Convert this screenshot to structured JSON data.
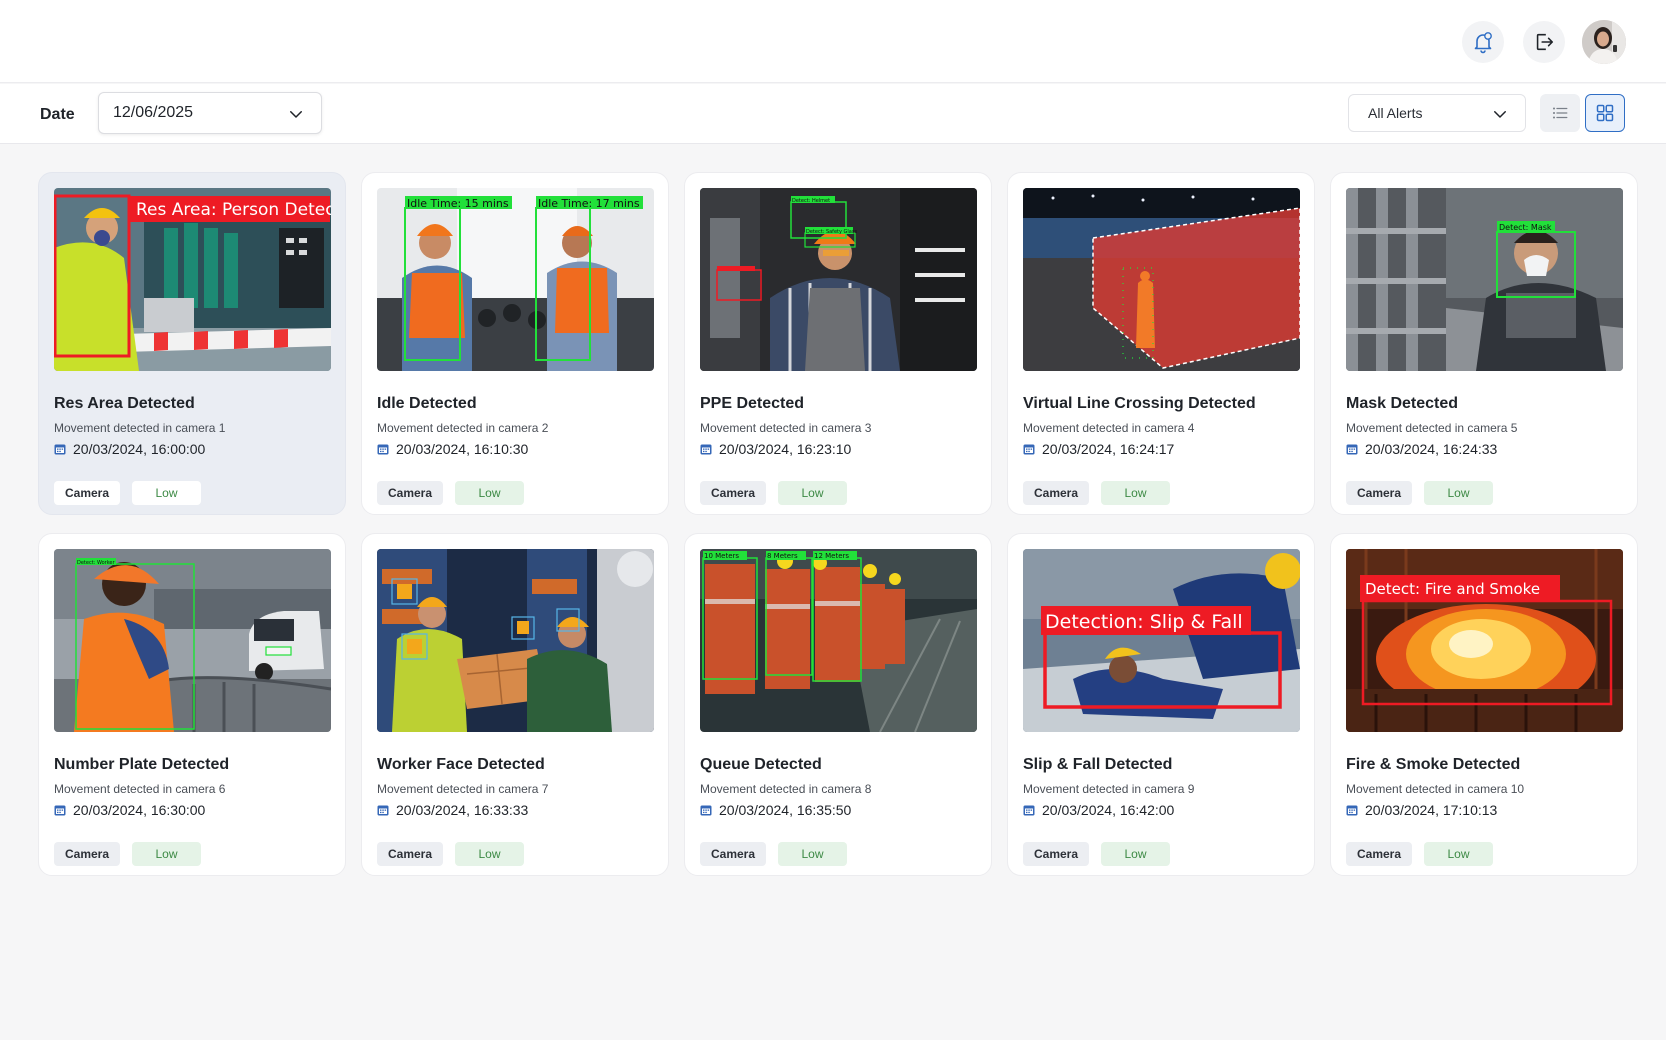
{
  "header": {
    "notification_icon": "bell-icon",
    "logout_icon": "logout-icon",
    "avatar_icon": "user-avatar"
  },
  "filters": {
    "date_label": "Date",
    "date_value": "12/06/2025",
    "alert_filter": "All Alerts",
    "list_view_icon": "list-icon",
    "grid_view_icon": "grid-icon"
  },
  "colors": {
    "accent": "#2f6ec5",
    "detection_red": "#ee1b24",
    "detection_green": "#22e03a",
    "low_badge_bg": "#e5f3e7",
    "low_badge_text": "#3d8a45"
  },
  "alerts": [
    {
      "title": "Res Area Detected",
      "subtitle": "Movement detected in camera 1",
      "datetime": "20/03/2024, 16:00:00",
      "source": "Camera",
      "severity": "Low",
      "overlay_labels": [
        "Res Area: Person Detect"
      ]
    },
    {
      "title": "Idle Detected",
      "subtitle": "Movement detected in camera 2",
      "datetime": "20/03/2024, 16:10:30",
      "source": "Camera",
      "severity": "Low",
      "overlay_labels": [
        "Idle Time: 15 mins",
        "Idle Time: 17 mins"
      ]
    },
    {
      "title": "PPE Detected",
      "subtitle": "Movement detected in camera 3",
      "datetime": "20/03/2024, 16:23:10",
      "source": "Camera",
      "severity": "Low",
      "overlay_labels": [
        "Detect: Helmet",
        "Detect: Safety Glass"
      ]
    },
    {
      "title": "Virtual Line Crossing Detected",
      "subtitle": "Movement detected in camera 4",
      "datetime": "20/03/2024, 16:24:17",
      "source": "Camera",
      "severity": "Low",
      "overlay_labels": []
    },
    {
      "title": "Mask Detected",
      "subtitle": "Movement detected in camera 5",
      "datetime": "20/03/2024, 16:24:33",
      "source": "Camera",
      "severity": "Low",
      "overlay_labels": [
        "Detect: Mask"
      ]
    },
    {
      "title": "Number Plate Detected",
      "subtitle": "Movement detected in camera 6",
      "datetime": "20/03/2024, 16:30:00",
      "source": "Camera",
      "severity": "Low",
      "overlay_labels": [
        "Detect: Worker"
      ]
    },
    {
      "title": "Worker Face Detected",
      "subtitle": "Movement detected in camera 7",
      "datetime": "20/03/2024, 16:33:33",
      "source": "Camera",
      "severity": "Low",
      "overlay_labels": []
    },
    {
      "title": "Queue Detected",
      "subtitle": "Movement detected in camera 8",
      "datetime": "20/03/2024, 16:35:50",
      "source": "Camera",
      "severity": "Low",
      "overlay_labels": [
        "10 Meters",
        "8 Meters",
        "12 Meters"
      ]
    },
    {
      "title": "Slip & Fall Detected",
      "subtitle": "Movement detected in camera 9",
      "datetime": "20/03/2024, 16:42:00",
      "source": "Camera",
      "severity": "Low",
      "overlay_labels": [
        "Detection: Slip & Fall"
      ]
    },
    {
      "title": "Fire & Smoke Detected",
      "subtitle": "Movement detected in camera 10",
      "datetime": "20/03/2024, 17:10:13",
      "source": "Camera",
      "severity": "Low",
      "overlay_labels": [
        "Detect: Fire and Smoke"
      ]
    }
  ]
}
